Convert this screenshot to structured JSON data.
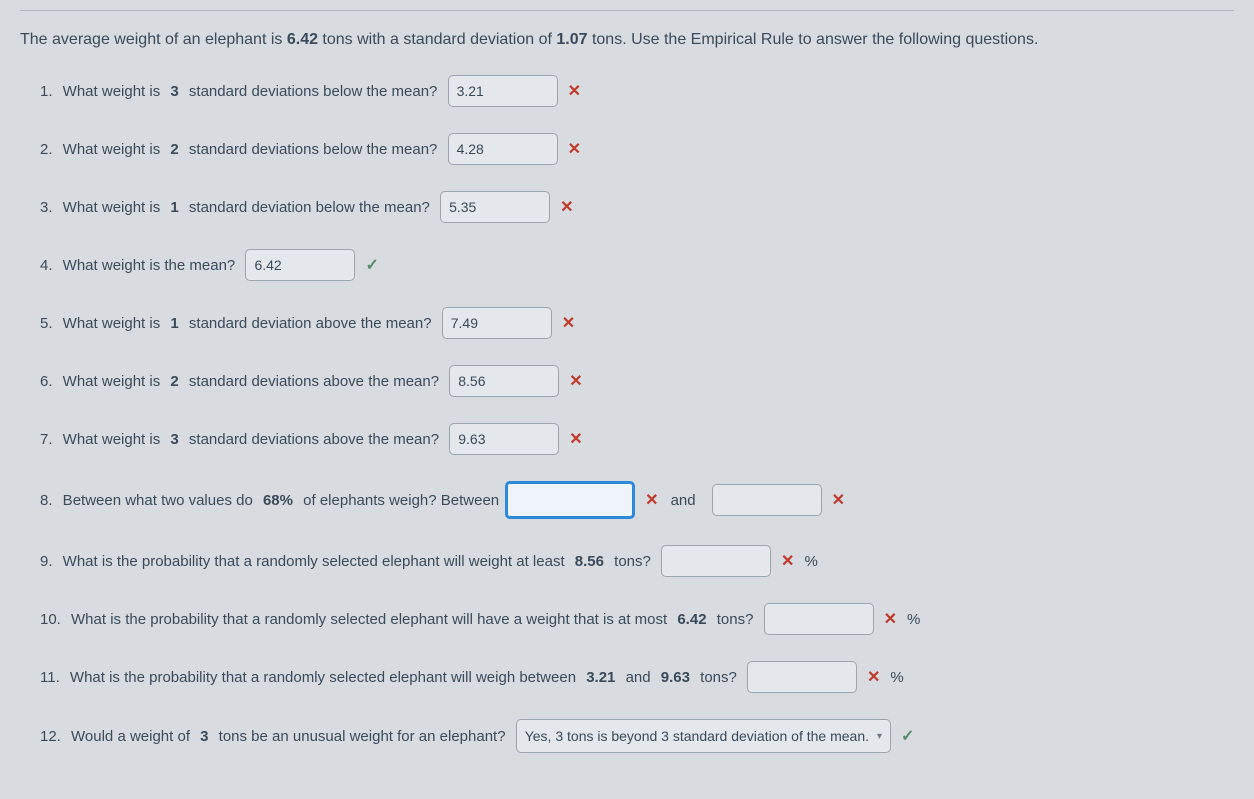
{
  "intro": {
    "prefix": "The average weight of an elephant is ",
    "mean": "6.42",
    "mid1": " tons with a standard deviation of ",
    "stddev": "1.07",
    "suffix": " tons. Use the Empirical Rule to answer the following questions."
  },
  "q1": {
    "num": "1.",
    "t1": " What weight is ",
    "b1": "3",
    "t2": " standard deviations below the mean? ",
    "val": "3.21",
    "mark": "✕"
  },
  "q2": {
    "num": "2.",
    "t1": " What weight is ",
    "b1": "2",
    "t2": " standard deviations below the mean? ",
    "val": "4.28",
    "mark": "✕"
  },
  "q3": {
    "num": "3.",
    "t1": " What weight is ",
    "b1": "1",
    "t2": " standard deviation below the mean? ",
    "val": "5.35",
    "mark": "✕"
  },
  "q4": {
    "num": "4.",
    "t1": " What weight is the mean? ",
    "val": "6.42",
    "mark": "✓"
  },
  "q5": {
    "num": "5.",
    "t1": " What weight is ",
    "b1": "1",
    "t2": " standard deviation above the mean? ",
    "val": "7.49",
    "mark": "✕"
  },
  "q6": {
    "num": "6.",
    "t1": " What weight is ",
    "b1": "2",
    "t2": " standard deviations above the mean? ",
    "val": "8.56",
    "mark": "✕"
  },
  "q7": {
    "num": "7.",
    "t1": " What weight is ",
    "b1": "3",
    "t2": " standard deviations above the mean? ",
    "val": "9.63",
    "mark": "✕"
  },
  "q8": {
    "num": "8.",
    "t1": " Between what two values do ",
    "b1": "68%",
    "t2": " of elephants weigh? Between",
    "val1": "",
    "mark1": "✕",
    "and": "and",
    "val2": "",
    "mark2": "✕"
  },
  "q9": {
    "num": "9.",
    "t1": " What is the probability that a randomly selected elephant will weight at least ",
    "b1": "8.56",
    "t2": " tons? ",
    "val": "",
    "mark": "✕",
    "pct": "%"
  },
  "q10": {
    "num": "10.",
    "t1": " What is the probability that a randomly selected elephant will have a weight that is at most ",
    "b1": "6.42",
    "t2": " tons? ",
    "val": "",
    "mark": "✕",
    "pct": "%"
  },
  "q11": {
    "num": "11.",
    "t1": " What is the probability that a randomly selected elephant will weigh between ",
    "b1": "3.21",
    "t2": " and ",
    "b2": "9.63",
    "t3": " tons? ",
    "val": "",
    "mark": "✕",
    "pct": "%"
  },
  "q12": {
    "num": "12.",
    "t1": " Would a weight of ",
    "b1": "3",
    "t2": " tons be an unusual weight for an elephant? ",
    "sel": "Yes, 3 tons is beyond 3 standard deviation of the mean.",
    "mark": "✓"
  }
}
